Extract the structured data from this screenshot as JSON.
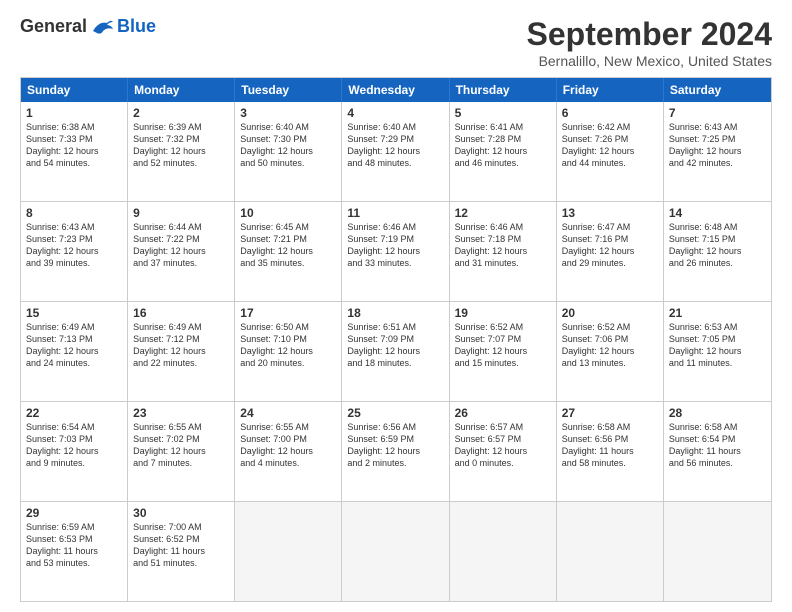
{
  "header": {
    "logo_general": "General",
    "logo_blue": "Blue",
    "title": "September 2024",
    "subtitle": "Bernalillo, New Mexico, United States"
  },
  "calendar": {
    "days": [
      "Sunday",
      "Monday",
      "Tuesday",
      "Wednesday",
      "Thursday",
      "Friday",
      "Saturday"
    ],
    "rows": [
      [
        {
          "num": "1",
          "lines": [
            "Sunrise: 6:38 AM",
            "Sunset: 7:33 PM",
            "Daylight: 12 hours",
            "and 54 minutes."
          ]
        },
        {
          "num": "2",
          "lines": [
            "Sunrise: 6:39 AM",
            "Sunset: 7:32 PM",
            "Daylight: 12 hours",
            "and 52 minutes."
          ]
        },
        {
          "num": "3",
          "lines": [
            "Sunrise: 6:40 AM",
            "Sunset: 7:30 PM",
            "Daylight: 12 hours",
            "and 50 minutes."
          ]
        },
        {
          "num": "4",
          "lines": [
            "Sunrise: 6:40 AM",
            "Sunset: 7:29 PM",
            "Daylight: 12 hours",
            "and 48 minutes."
          ]
        },
        {
          "num": "5",
          "lines": [
            "Sunrise: 6:41 AM",
            "Sunset: 7:28 PM",
            "Daylight: 12 hours",
            "and 46 minutes."
          ]
        },
        {
          "num": "6",
          "lines": [
            "Sunrise: 6:42 AM",
            "Sunset: 7:26 PM",
            "Daylight: 12 hours",
            "and 44 minutes."
          ]
        },
        {
          "num": "7",
          "lines": [
            "Sunrise: 6:43 AM",
            "Sunset: 7:25 PM",
            "Daylight: 12 hours",
            "and 42 minutes."
          ]
        }
      ],
      [
        {
          "num": "8",
          "lines": [
            "Sunrise: 6:43 AM",
            "Sunset: 7:23 PM",
            "Daylight: 12 hours",
            "and 39 minutes."
          ]
        },
        {
          "num": "9",
          "lines": [
            "Sunrise: 6:44 AM",
            "Sunset: 7:22 PM",
            "Daylight: 12 hours",
            "and 37 minutes."
          ]
        },
        {
          "num": "10",
          "lines": [
            "Sunrise: 6:45 AM",
            "Sunset: 7:21 PM",
            "Daylight: 12 hours",
            "and 35 minutes."
          ]
        },
        {
          "num": "11",
          "lines": [
            "Sunrise: 6:46 AM",
            "Sunset: 7:19 PM",
            "Daylight: 12 hours",
            "and 33 minutes."
          ]
        },
        {
          "num": "12",
          "lines": [
            "Sunrise: 6:46 AM",
            "Sunset: 7:18 PM",
            "Daylight: 12 hours",
            "and 31 minutes."
          ]
        },
        {
          "num": "13",
          "lines": [
            "Sunrise: 6:47 AM",
            "Sunset: 7:16 PM",
            "Daylight: 12 hours",
            "and 29 minutes."
          ]
        },
        {
          "num": "14",
          "lines": [
            "Sunrise: 6:48 AM",
            "Sunset: 7:15 PM",
            "Daylight: 12 hours",
            "and 26 minutes."
          ]
        }
      ],
      [
        {
          "num": "15",
          "lines": [
            "Sunrise: 6:49 AM",
            "Sunset: 7:13 PM",
            "Daylight: 12 hours",
            "and 24 minutes."
          ]
        },
        {
          "num": "16",
          "lines": [
            "Sunrise: 6:49 AM",
            "Sunset: 7:12 PM",
            "Daylight: 12 hours",
            "and 22 minutes."
          ]
        },
        {
          "num": "17",
          "lines": [
            "Sunrise: 6:50 AM",
            "Sunset: 7:10 PM",
            "Daylight: 12 hours",
            "and 20 minutes."
          ]
        },
        {
          "num": "18",
          "lines": [
            "Sunrise: 6:51 AM",
            "Sunset: 7:09 PM",
            "Daylight: 12 hours",
            "and 18 minutes."
          ]
        },
        {
          "num": "19",
          "lines": [
            "Sunrise: 6:52 AM",
            "Sunset: 7:07 PM",
            "Daylight: 12 hours",
            "and 15 minutes."
          ]
        },
        {
          "num": "20",
          "lines": [
            "Sunrise: 6:52 AM",
            "Sunset: 7:06 PM",
            "Daylight: 12 hours",
            "and 13 minutes."
          ]
        },
        {
          "num": "21",
          "lines": [
            "Sunrise: 6:53 AM",
            "Sunset: 7:05 PM",
            "Daylight: 12 hours",
            "and 11 minutes."
          ]
        }
      ],
      [
        {
          "num": "22",
          "lines": [
            "Sunrise: 6:54 AM",
            "Sunset: 7:03 PM",
            "Daylight: 12 hours",
            "and 9 minutes."
          ]
        },
        {
          "num": "23",
          "lines": [
            "Sunrise: 6:55 AM",
            "Sunset: 7:02 PM",
            "Daylight: 12 hours",
            "and 7 minutes."
          ]
        },
        {
          "num": "24",
          "lines": [
            "Sunrise: 6:55 AM",
            "Sunset: 7:00 PM",
            "Daylight: 12 hours",
            "and 4 minutes."
          ]
        },
        {
          "num": "25",
          "lines": [
            "Sunrise: 6:56 AM",
            "Sunset: 6:59 PM",
            "Daylight: 12 hours",
            "and 2 minutes."
          ]
        },
        {
          "num": "26",
          "lines": [
            "Sunrise: 6:57 AM",
            "Sunset: 6:57 PM",
            "Daylight: 12 hours",
            "and 0 minutes."
          ]
        },
        {
          "num": "27",
          "lines": [
            "Sunrise: 6:58 AM",
            "Sunset: 6:56 PM",
            "Daylight: 11 hours",
            "and 58 minutes."
          ]
        },
        {
          "num": "28",
          "lines": [
            "Sunrise: 6:58 AM",
            "Sunset: 6:54 PM",
            "Daylight: 11 hours",
            "and 56 minutes."
          ]
        }
      ],
      [
        {
          "num": "29",
          "lines": [
            "Sunrise: 6:59 AM",
            "Sunset: 6:53 PM",
            "Daylight: 11 hours",
            "and 53 minutes."
          ]
        },
        {
          "num": "30",
          "lines": [
            "Sunrise: 7:00 AM",
            "Sunset: 6:52 PM",
            "Daylight: 11 hours",
            "and 51 minutes."
          ]
        },
        {
          "num": "",
          "lines": []
        },
        {
          "num": "",
          "lines": []
        },
        {
          "num": "",
          "lines": []
        },
        {
          "num": "",
          "lines": []
        },
        {
          "num": "",
          "lines": []
        }
      ]
    ]
  }
}
